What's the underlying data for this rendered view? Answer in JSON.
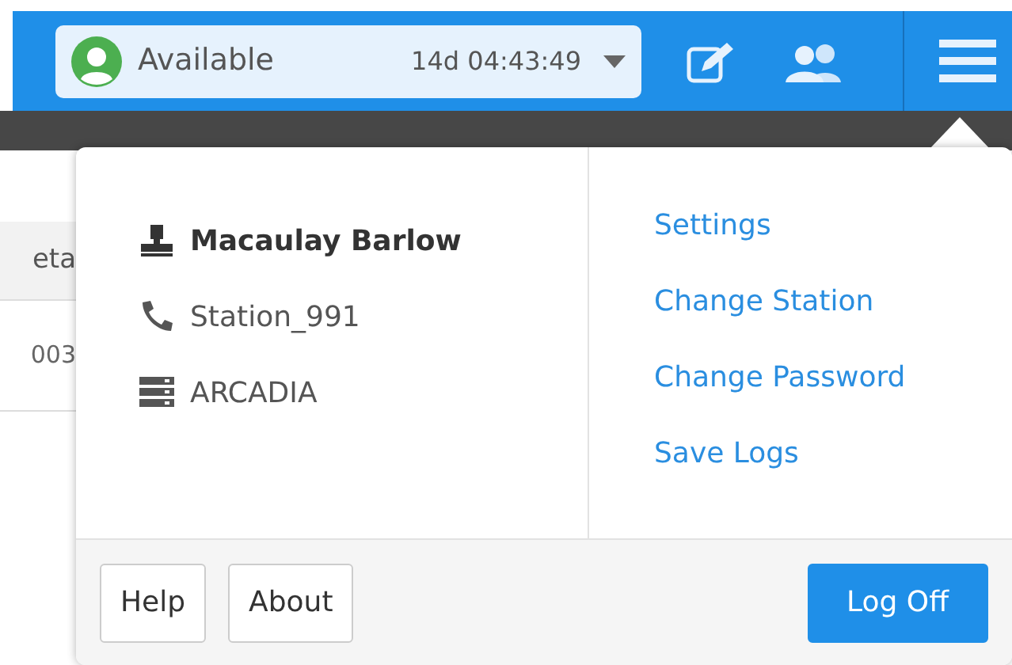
{
  "status": {
    "label": "Available",
    "timer": "14d 04:43:49"
  },
  "table": {
    "column_1": "eta",
    "rows": [
      {
        "column_1": "003"
      }
    ]
  },
  "user": {
    "name": "Macaulay Barlow",
    "station": "Station_991",
    "server": "ARCADIA"
  },
  "links": [
    "Settings",
    "Change Station",
    "Change Password",
    "Save Logs"
  ],
  "footer_buttons": [
    {
      "label": "Help",
      "kind": "plain"
    },
    {
      "label": "About",
      "kind": "plain"
    },
    {
      "label": "Log Off",
      "kind": "primary"
    }
  ]
}
